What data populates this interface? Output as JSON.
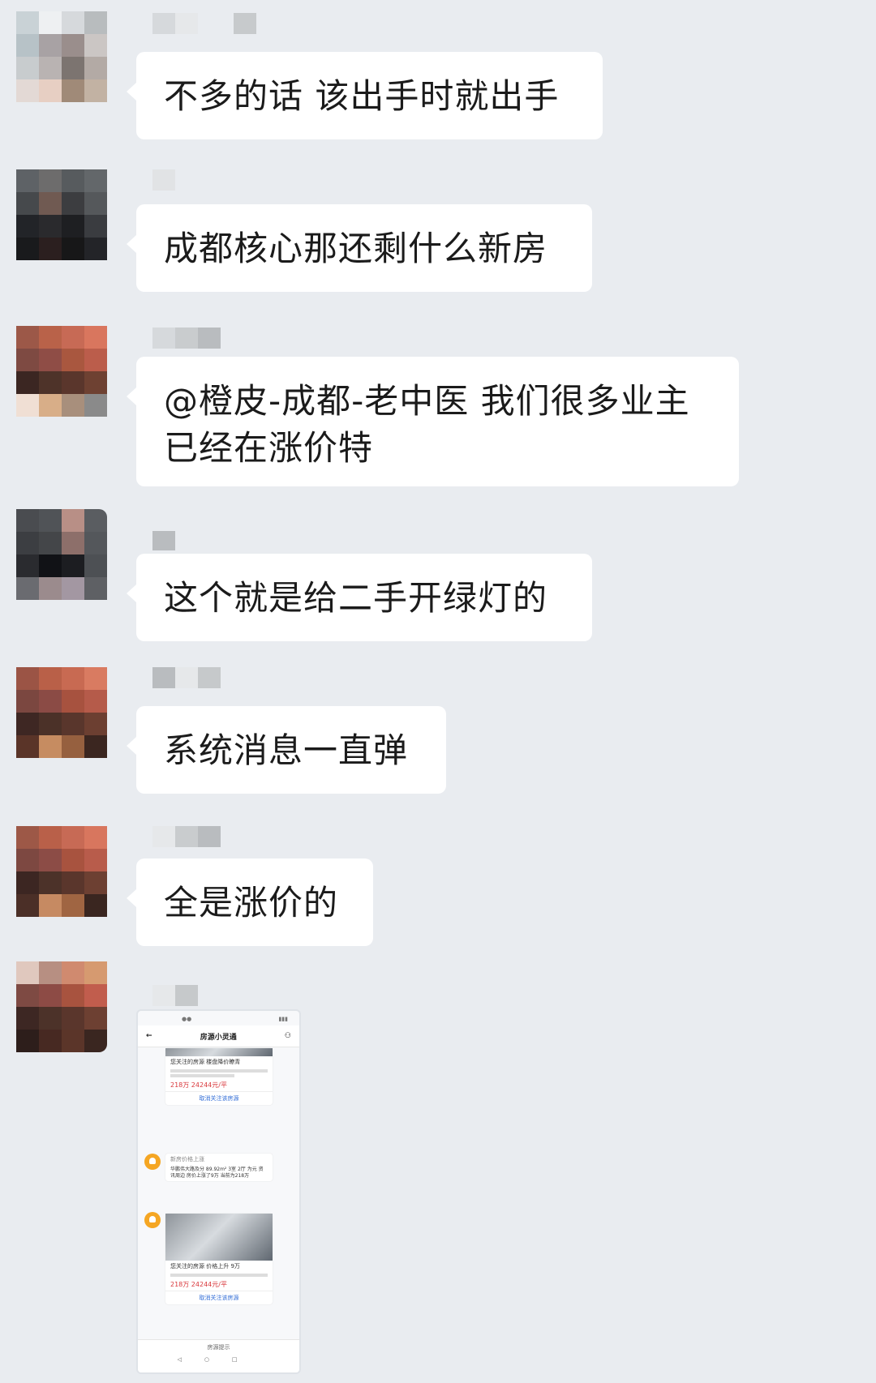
{
  "messages": [
    {
      "text": "不多的话 该出手时就出手"
    },
    {
      "text": "成都核心那还剩什么新房"
    },
    {
      "text": "@橙皮-成都-老中医  我们很多业主已经在涨价特"
    },
    {
      "text": "这个就是给二手开绿灯的"
    },
    {
      "text": "系统消息一直弹"
    },
    {
      "text": "全是涨价的"
    }
  ],
  "screenshot": {
    "title": "房源小灵通",
    "card1_title": "您关注的房源 楼盘降价瞭青",
    "card1_price": "218万 24244元/平",
    "card1_link": "取消关注该房源",
    "card2_title": "新房价格上涨",
    "card2_body": "华鹏伟大路及分 89.92m² 3室 2厅 为元 资讯周边 房价上涨了9万 当前为218万",
    "card3_title": "您关注的房源 价格上升 9万",
    "card3_price": "218万 24244元/平",
    "card3_link": "取消关注该房源",
    "footer": "房源提示"
  },
  "colors": {
    "bubble": "#ffffff",
    "background": "#e9ecf0",
    "price": "#d9383c",
    "link": "#2f6bd6",
    "bell": "#f5a623"
  }
}
